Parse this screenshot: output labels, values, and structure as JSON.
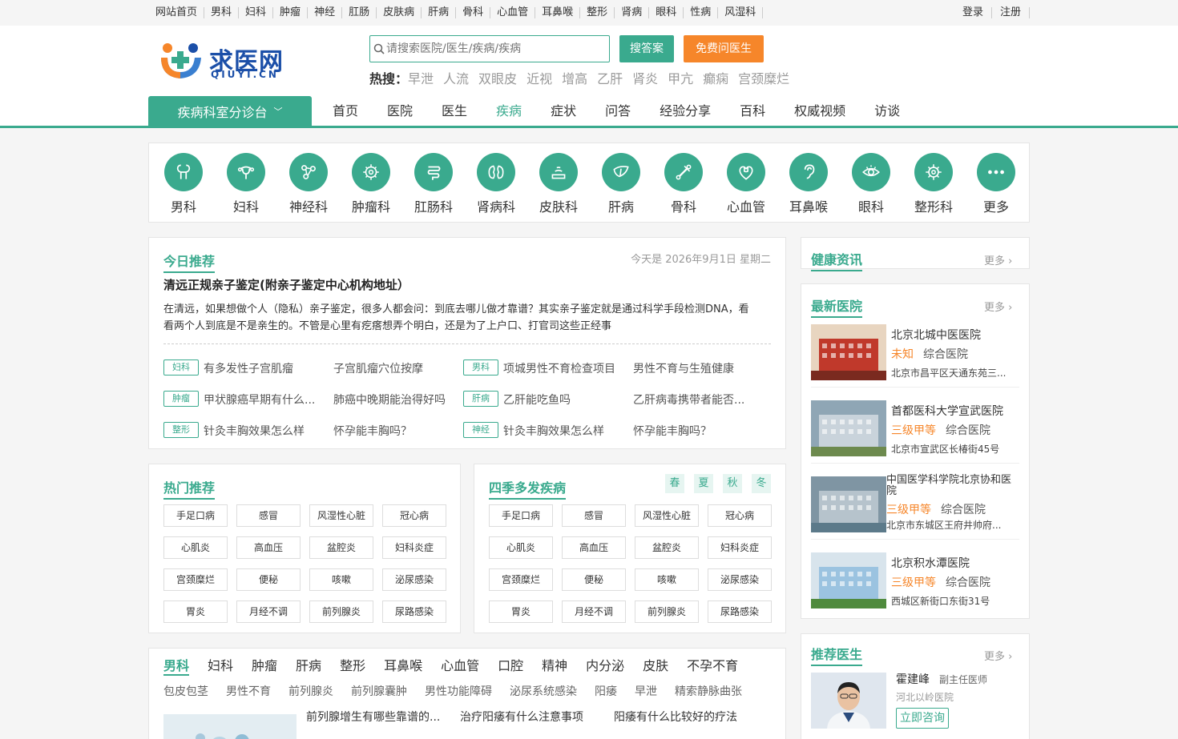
{
  "topbar": {
    "nav": [
      "网站首页",
      "男科",
      "妇科",
      "肿瘤",
      "神经",
      "肛肠",
      "皮肤病",
      "肝病",
      "骨科",
      "心血管",
      "耳鼻喉",
      "整形",
      "肾病",
      "眼科",
      "性病",
      "风湿科"
    ],
    "login": "登录",
    "register": "注册"
  },
  "header": {
    "logo_text": "求医网",
    "logo_sub": "QIUYI.CN",
    "search_placeholder": "请搜索医院/医生/疾病/疾病",
    "search_button": "搜答案",
    "ask_button": "免费问医生",
    "hot_label": "热搜：",
    "hot_keywords": [
      "早泄",
      "人流",
      "双眼皮",
      "近视",
      "增高",
      "乙肝",
      "肾炎",
      "甲亢",
      "癫痫",
      "宫颈糜烂"
    ]
  },
  "mainnav": {
    "category_label": "疾病科室分诊台",
    "items": [
      "首页",
      "医院",
      "医生",
      "疾病",
      "症状",
      "问答",
      "经验分享",
      "百科",
      "权威视频",
      "访谈"
    ],
    "active_index": 3
  },
  "departments": [
    {
      "label": "男科",
      "icon": "male-icon"
    },
    {
      "label": "妇科",
      "icon": "uterus-icon"
    },
    {
      "label": "神经科",
      "icon": "neuron-icon"
    },
    {
      "label": "肿瘤科",
      "icon": "cell-icon"
    },
    {
      "label": "肛肠科",
      "icon": "intestine-icon"
    },
    {
      "label": "肾病科",
      "icon": "kidney-icon"
    },
    {
      "label": "皮肤科",
      "icon": "skin-icon"
    },
    {
      "label": "肝病",
      "icon": "liver-icon"
    },
    {
      "label": "骨科",
      "icon": "bone-icon"
    },
    {
      "label": "心血管",
      "icon": "heart-icon"
    },
    {
      "label": "耳鼻喉",
      "icon": "ear-icon"
    },
    {
      "label": "眼科",
      "icon": "eye-icon"
    },
    {
      "label": "整形科",
      "icon": "gear-icon"
    },
    {
      "label": "更多",
      "icon": "more-icon"
    }
  ],
  "today": {
    "title": "今日推荐",
    "date": "今天是 2026年9月1日 星期二",
    "headline": "清远正规亲子鉴定(附亲子鉴定中心机构地址）",
    "desc": "在清远，如果想做个人（隐私）亲子鉴定，很多人都会问：到底去哪儿做才靠谱？其实亲子鉴定就是通过科学手段检测DNA，看看两个人到底是不是亲生的。不管是心里有疙瘩想弄个明白，还是为了上户口、打官司这些正经事",
    "rows": [
      {
        "tag1": "妇科",
        "a": "有多发性子宫肌瘤",
        "b": "子宫肌瘤穴位按摩",
        "tag2": "男科",
        "c": "项城男性不育检查项目",
        "d": "男性不育与生殖健康"
      },
      {
        "tag1": "肿瘤",
        "a": "甲状腺癌早期有什么...",
        "b": "肺癌中晚期能治得好吗",
        "tag2": "肝病",
        "c": "乙肝能吃鱼吗",
        "d": "乙肝病毒携带者能否..."
      },
      {
        "tag1": "整形",
        "a": "针灸丰胸效果怎么样",
        "b": "怀孕能丰胸吗？",
        "tag2": "神经",
        "c": "针灸丰胸效果怎么样",
        "d": "怀孕能丰胸吗？"
      }
    ]
  },
  "hot": {
    "title": "热门推荐",
    "chips": [
      "手足口病",
      "感冒",
      "风湿性心脏",
      "冠心病",
      "心肌炎",
      "高血压",
      "盆腔炎",
      "妇科炎症",
      "宫颈糜烂",
      "便秘",
      "咳嗽",
      "泌尿感染",
      "胃炎",
      "月经不调",
      "前列腺炎",
      "尿路感染"
    ]
  },
  "season": {
    "title": "四季多发疾病",
    "seasons": [
      "春",
      "夏",
      "秋",
      "冬"
    ],
    "chips": [
      "手足口病",
      "感冒",
      "风湿性心脏",
      "冠心病",
      "心肌炎",
      "高血压",
      "盆腔炎",
      "妇科炎症",
      "宫颈糜烂",
      "便秘",
      "咳嗽",
      "泌尿感染",
      "胃炎",
      "月经不调",
      "前列腺炎",
      "尿路感染"
    ]
  },
  "news": {
    "title": "健康资讯",
    "more": "更多"
  },
  "hospitals": {
    "title": "最新医院",
    "more": "更多",
    "items": [
      {
        "name": "北京北城中医医院",
        "level": "未知",
        "type": "综合医院",
        "addr": "北京市昌平区天通东苑三..."
      },
      {
        "name": "首都医科大学宣武医院",
        "level": "三级甲等",
        "type": "综合医院",
        "addr": "北京市宣武区长椿街45号"
      },
      {
        "name": "中国医学科学院北京协和医院",
        "level": "三级甲等",
        "type": "综合医院",
        "addr": "北京市东城区王府井帅府..."
      },
      {
        "name": "北京积水潭医院",
        "level": "三级甲等",
        "type": "综合医院",
        "addr": "西城区新街口东街31号"
      }
    ]
  },
  "doctors": {
    "title": "推荐医生",
    "more": "更多",
    "name": "霍建峰",
    "rank": "副主任医师",
    "hospital": "河北以岭医院",
    "consult": "立即咨询"
  },
  "bottom": {
    "tabs": [
      "男科",
      "妇科",
      "肿瘤",
      "肝病",
      "整形",
      "耳鼻喉",
      "心血管",
      "口腔",
      "精神",
      "内分泌",
      "皮肤",
      "不孕不育"
    ],
    "subs": [
      "包皮包茎",
      "男性不育",
      "前列腺炎",
      "前列腺囊肿",
      "男性功能障碍",
      "泌尿系统感染",
      "阳痿",
      "早泄",
      "精索静脉曲张"
    ],
    "links": [
      "前列腺增生有哪些靠谱的...",
      "治疗阳痿有什么注意事项",
      "阳痿有什么比较好的疗法"
    ]
  },
  "colors": {
    "accent": "#3aaa8e",
    "orange": "#f6862a",
    "brand_blue": "#1b4fa8"
  }
}
